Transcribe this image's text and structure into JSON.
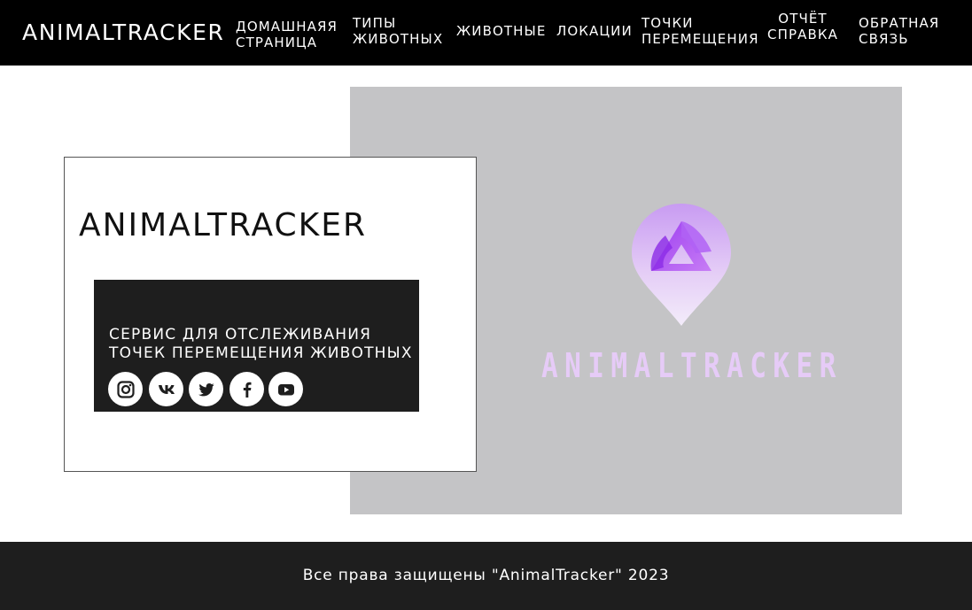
{
  "header": {
    "brand": "ANIMALTRACKER",
    "nav": [
      {
        "label": "Домашнаяя\nстраница"
      },
      {
        "label": "Типы\nживотных"
      },
      {
        "label": "Животные"
      },
      {
        "label": "Локации"
      },
      {
        "label": "Точки\nперемещения"
      },
      {
        "label": "Отчёт\nсправка"
      },
      {
        "label": "Обратная\nсвязь"
      }
    ]
  },
  "hero": {
    "title": "ANIMALTRACKER",
    "tagline": "Сервис для отслеживания\nточек перемещения животных",
    "logo_text": "AnimalTracker",
    "image_bg": "#c4c4c6",
    "logo_colors": [
      "#a855f7",
      "#e9d5ff"
    ]
  },
  "social": [
    {
      "name": "instagram-icon"
    },
    {
      "name": "vk-icon"
    },
    {
      "name": "twitter-icon"
    },
    {
      "name": "facebook-icon"
    },
    {
      "name": "youtube-icon"
    }
  ],
  "footer": {
    "text": "Все права защищены \"AnimalTracker\" 2023"
  }
}
